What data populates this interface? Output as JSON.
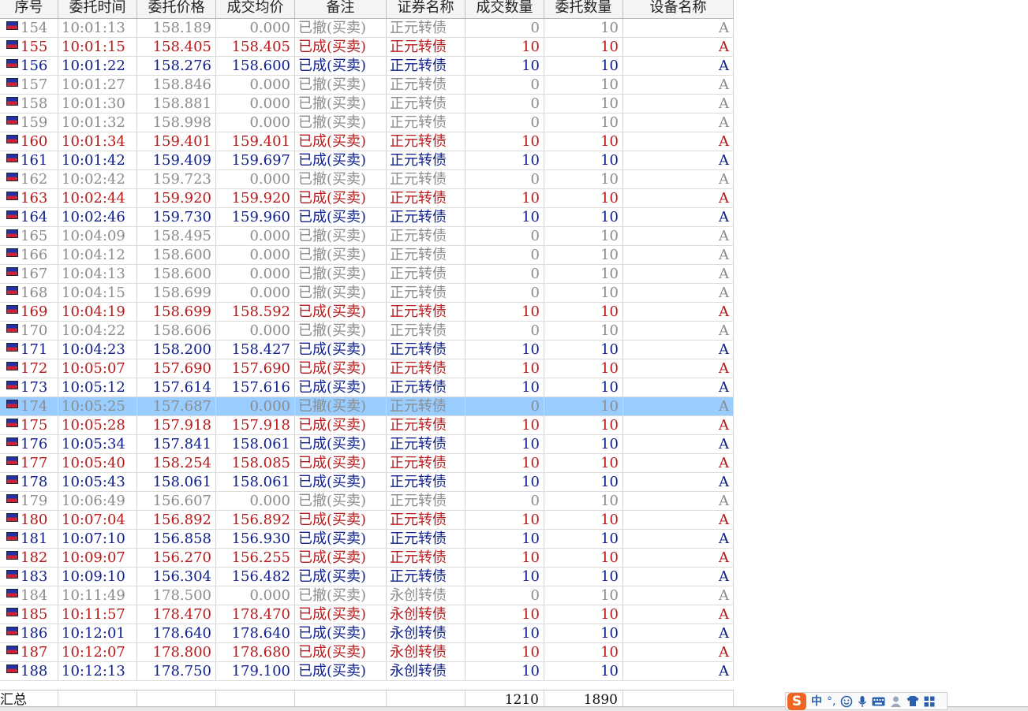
{
  "columns": [
    "序号",
    "委托时间",
    "委托价格",
    "成交均价",
    "备注",
    "证券名称",
    "成交数量",
    "委托数量",
    "设备名称"
  ],
  "rows": [
    {
      "id": "154",
      "time": "10:01:13",
      "price": "158.189",
      "avg": "0.000",
      "note": "已撤(买卖)",
      "name": "正元转债",
      "filled": "0",
      "qty": "10",
      "device": "A",
      "status": "cancel"
    },
    {
      "id": "155",
      "time": "10:01:15",
      "price": "158.405",
      "avg": "158.405",
      "note": "已成(买卖)",
      "name": "正元转债",
      "filled": "10",
      "qty": "10",
      "device": "A",
      "status": "buy"
    },
    {
      "id": "156",
      "time": "10:01:22",
      "price": "158.276",
      "avg": "158.600",
      "note": "已成(买卖)",
      "name": "正元转债",
      "filled": "10",
      "qty": "10",
      "device": "A",
      "status": "sell"
    },
    {
      "id": "157",
      "time": "10:01:27",
      "price": "158.846",
      "avg": "0.000",
      "note": "已撤(买卖)",
      "name": "正元转债",
      "filled": "0",
      "qty": "10",
      "device": "A",
      "status": "cancel"
    },
    {
      "id": "158",
      "time": "10:01:30",
      "price": "158.881",
      "avg": "0.000",
      "note": "已撤(买卖)",
      "name": "正元转债",
      "filled": "0",
      "qty": "10",
      "device": "A",
      "status": "cancel"
    },
    {
      "id": "159",
      "time": "10:01:32",
      "price": "158.998",
      "avg": "0.000",
      "note": "已撤(买卖)",
      "name": "正元转债",
      "filled": "0",
      "qty": "10",
      "device": "A",
      "status": "cancel"
    },
    {
      "id": "160",
      "time": "10:01:34",
      "price": "159.401",
      "avg": "159.401",
      "note": "已成(买卖)",
      "name": "正元转债",
      "filled": "10",
      "qty": "10",
      "device": "A",
      "status": "buy"
    },
    {
      "id": "161",
      "time": "10:01:42",
      "price": "159.409",
      "avg": "159.697",
      "note": "已成(买卖)",
      "name": "正元转债",
      "filled": "10",
      "qty": "10",
      "device": "A",
      "status": "sell"
    },
    {
      "id": "162",
      "time": "10:02:42",
      "price": "159.723",
      "avg": "0.000",
      "note": "已撤(买卖)",
      "name": "正元转债",
      "filled": "0",
      "qty": "10",
      "device": "A",
      "status": "cancel"
    },
    {
      "id": "163",
      "time": "10:02:44",
      "price": "159.920",
      "avg": "159.920",
      "note": "已成(买卖)",
      "name": "正元转债",
      "filled": "10",
      "qty": "10",
      "device": "A",
      "status": "buy"
    },
    {
      "id": "164",
      "time": "10:02:46",
      "price": "159.730",
      "avg": "159.960",
      "note": "已成(买卖)",
      "name": "正元转债",
      "filled": "10",
      "qty": "10",
      "device": "A",
      "status": "sell"
    },
    {
      "id": "165",
      "time": "10:04:09",
      "price": "158.495",
      "avg": "0.000",
      "note": "已撤(买卖)",
      "name": "正元转债",
      "filled": "0",
      "qty": "10",
      "device": "A",
      "status": "cancel"
    },
    {
      "id": "166",
      "time": "10:04:12",
      "price": "158.600",
      "avg": "0.000",
      "note": "已撤(买卖)",
      "name": "正元转债",
      "filled": "0",
      "qty": "10",
      "device": "A",
      "status": "cancel"
    },
    {
      "id": "167",
      "time": "10:04:13",
      "price": "158.600",
      "avg": "0.000",
      "note": "已撤(买卖)",
      "name": "正元转债",
      "filled": "0",
      "qty": "10",
      "device": "A",
      "status": "cancel"
    },
    {
      "id": "168",
      "time": "10:04:15",
      "price": "158.699",
      "avg": "0.000",
      "note": "已撤(买卖)",
      "name": "正元转债",
      "filled": "0",
      "qty": "10",
      "device": "A",
      "status": "cancel"
    },
    {
      "id": "169",
      "time": "10:04:19",
      "price": "158.699",
      "avg": "158.592",
      "note": "已成(买卖)",
      "name": "正元转债",
      "filled": "10",
      "qty": "10",
      "device": "A",
      "status": "buy"
    },
    {
      "id": "170",
      "time": "10:04:22",
      "price": "158.606",
      "avg": "0.000",
      "note": "已撤(买卖)",
      "name": "正元转债",
      "filled": "0",
      "qty": "10",
      "device": "A",
      "status": "cancel"
    },
    {
      "id": "171",
      "time": "10:04:23",
      "price": "158.200",
      "avg": "158.427",
      "note": "已成(买卖)",
      "name": "正元转债",
      "filled": "10",
      "qty": "10",
      "device": "A",
      "status": "sell"
    },
    {
      "id": "172",
      "time": "10:05:07",
      "price": "157.690",
      "avg": "157.690",
      "note": "已成(买卖)",
      "name": "正元转债",
      "filled": "10",
      "qty": "10",
      "device": "A",
      "status": "buy"
    },
    {
      "id": "173",
      "time": "10:05:12",
      "price": "157.614",
      "avg": "157.616",
      "note": "已成(买卖)",
      "name": "正元转债",
      "filled": "10",
      "qty": "10",
      "device": "A",
      "status": "sell"
    },
    {
      "id": "174",
      "time": "10:05:25",
      "price": "157.687",
      "avg": "0.000",
      "note": "已撤(买卖)",
      "name": "正元转债",
      "filled": "0",
      "qty": "10",
      "device": "A",
      "status": "cancel",
      "selected": true
    },
    {
      "id": "175",
      "time": "10:05:28",
      "price": "157.918",
      "avg": "157.918",
      "note": "已成(买卖)",
      "name": "正元转债",
      "filled": "10",
      "qty": "10",
      "device": "A",
      "status": "buy"
    },
    {
      "id": "176",
      "time": "10:05:34",
      "price": "157.841",
      "avg": "158.061",
      "note": "已成(买卖)",
      "name": "正元转债",
      "filled": "10",
      "qty": "10",
      "device": "A",
      "status": "sell"
    },
    {
      "id": "177",
      "time": "10:05:40",
      "price": "158.254",
      "avg": "158.085",
      "note": "已成(买卖)",
      "name": "正元转债",
      "filled": "10",
      "qty": "10",
      "device": "A",
      "status": "buy"
    },
    {
      "id": "178",
      "time": "10:05:43",
      "price": "158.061",
      "avg": "158.061",
      "note": "已成(买卖)",
      "name": "正元转债",
      "filled": "10",
      "qty": "10",
      "device": "A",
      "status": "sell"
    },
    {
      "id": "179",
      "time": "10:06:49",
      "price": "156.607",
      "avg": "0.000",
      "note": "已撤(买卖)",
      "name": "正元转债",
      "filled": "0",
      "qty": "10",
      "device": "A",
      "status": "cancel"
    },
    {
      "id": "180",
      "time": "10:07:04",
      "price": "156.892",
      "avg": "156.892",
      "note": "已成(买卖)",
      "name": "正元转债",
      "filled": "10",
      "qty": "10",
      "device": "A",
      "status": "buy"
    },
    {
      "id": "181",
      "time": "10:07:10",
      "price": "156.858",
      "avg": "156.930",
      "note": "已成(买卖)",
      "name": "正元转债",
      "filled": "10",
      "qty": "10",
      "device": "A",
      "status": "sell"
    },
    {
      "id": "182",
      "time": "10:09:07",
      "price": "156.270",
      "avg": "156.255",
      "note": "已成(买卖)",
      "name": "正元转债",
      "filled": "10",
      "qty": "10",
      "device": "A",
      "status": "buy"
    },
    {
      "id": "183",
      "time": "10:09:10",
      "price": "156.304",
      "avg": "156.482",
      "note": "已成(买卖)",
      "name": "正元转债",
      "filled": "10",
      "qty": "10",
      "device": "A",
      "status": "sell"
    },
    {
      "id": "184",
      "time": "10:11:49",
      "price": "178.500",
      "avg": "0.000",
      "note": "已撤(买卖)",
      "name": "永创转债",
      "filled": "0",
      "qty": "10",
      "device": "A",
      "status": "cancel"
    },
    {
      "id": "185",
      "time": "10:11:57",
      "price": "178.470",
      "avg": "178.470",
      "note": "已成(买卖)",
      "name": "永创转债",
      "filled": "10",
      "qty": "10",
      "device": "A",
      "status": "buy"
    },
    {
      "id": "186",
      "time": "10:12:01",
      "price": "178.640",
      "avg": "178.640",
      "note": "已成(买卖)",
      "name": "永创转债",
      "filled": "10",
      "qty": "10",
      "device": "A",
      "status": "sell"
    },
    {
      "id": "187",
      "time": "10:12:07",
      "price": "178.800",
      "avg": "178.680",
      "note": "已成(买卖)",
      "name": "永创转债",
      "filled": "10",
      "qty": "10",
      "device": "A",
      "status": "buy"
    },
    {
      "id": "188",
      "time": "10:12:13",
      "price": "178.750",
      "avg": "179.100",
      "note": "已成(买卖)",
      "name": "永创转债",
      "filled": "10",
      "qty": "10",
      "device": "A",
      "status": "sell"
    }
  ],
  "summary": {
    "label": "汇总",
    "filled_total": "1210",
    "qty_total": "1890"
  },
  "colors": {
    "cancel": "#8c8c8c",
    "buy": "#b81a1a",
    "sell": "#10208c",
    "selected": "#99ccff"
  },
  "ime": {
    "logo": "S",
    "mode": "中",
    "punct": "°,",
    "icons": [
      "emoji-icon",
      "mic-icon",
      "keyboard-icon",
      "user-icon",
      "skin-icon",
      "grid-icon"
    ]
  }
}
